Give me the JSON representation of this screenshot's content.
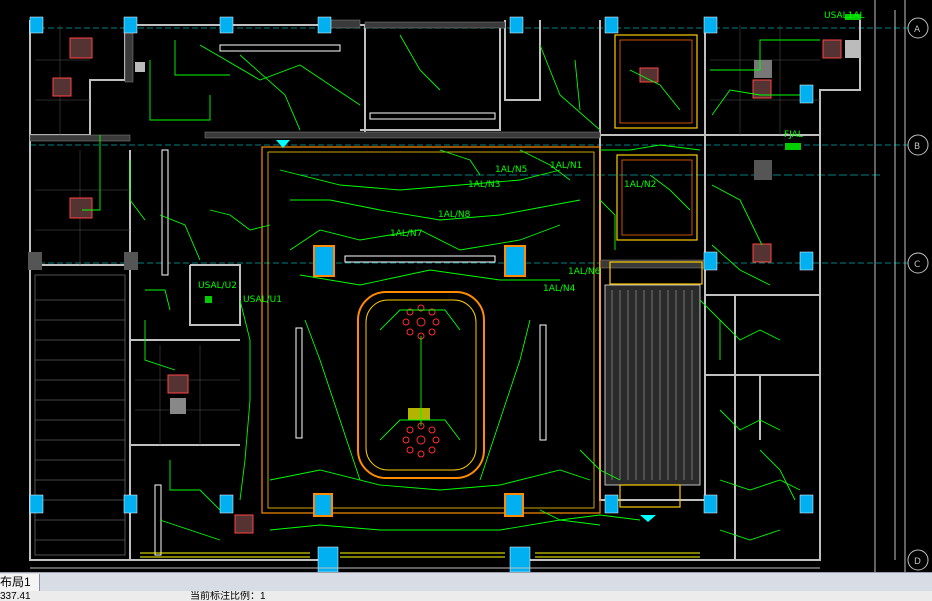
{
  "drawing": {
    "grid_labels": [
      "A",
      "B",
      "C",
      "D"
    ],
    "room_labels": [
      "USAL1AL",
      "FJAL",
      "1AL/N5",
      "1AL/N1",
      "1AL/N3",
      "1AL/N2",
      "1AL/N8",
      "1AL/N7",
      "1AL/N6",
      "1AL/N4",
      "USAL/U2",
      "USAL/U1"
    ],
    "colors": {
      "background": "#000000",
      "wall": "#c0c0c0",
      "wiring": "#00ff00",
      "column": "#00b0f0",
      "axis": "#00ffff",
      "accent": "#ff6600"
    }
  },
  "tabs": {
    "layout": "布局1"
  },
  "status": {
    "left": "337.41",
    "middle": "当前标注比例：1"
  }
}
